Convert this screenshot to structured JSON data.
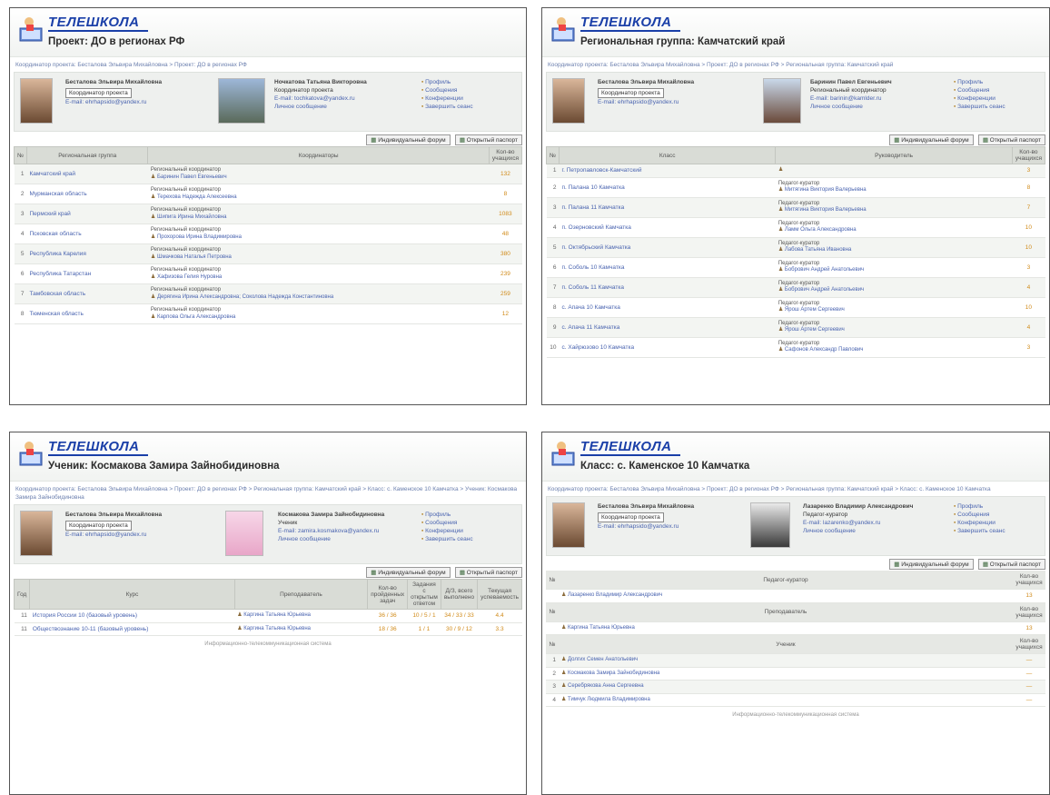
{
  "brand": "ТЕЛЕШКОЛА",
  "colors": {
    "brand": "#1a3fa8",
    "link": "#4a64b0",
    "value": "#d18b1a"
  },
  "common": {
    "coordinator_name": "Бесталова Эльвира Михайловна",
    "coordinator_role": "Координатор проекта",
    "coordinator_email": "E-mail: ehrhapsido@yandex.ru",
    "side_links": [
      "Профиль",
      "Сообщения",
      "Конференции",
      "Завершить сеанс"
    ],
    "btn_calendar": "Индивидуальный форум",
    "btn_report": "Открытый паспорт",
    "footer": "Информационно-телекоммуникационная система"
  },
  "panel1": {
    "title": "Проект: ДО в регионах РФ",
    "crumbs": "Координатор проекта: Бесталова Эльвира Михайловна > Проект: ДО в регионах РФ",
    "user2_name": "Ночкатова Татьяна Викторовна",
    "user2_role": "Координатор проекта",
    "user2_email": "E-mail: tochkatova@yandex.ru",
    "user2_msg": "Личное сообщение",
    "headers": [
      "№",
      "Региональная группа",
      "Координаторы",
      "Кол-во учащихся"
    ],
    "rows": [
      {
        "n": "1",
        "name": "Камчатский край",
        "role": "Региональный координатор",
        "person": "Баринин Павел Евгеньевич",
        "v": "132"
      },
      {
        "n": "2",
        "name": "Мурманская область",
        "role": "Региональный координатор",
        "person": "Терехова Надежда Алексеевна",
        "v": "8"
      },
      {
        "n": "3",
        "name": "Пермский край",
        "role": "Региональный координатор",
        "person": "Шипига Ирина Михайловна",
        "v": "1083"
      },
      {
        "n": "4",
        "name": "Псковская область",
        "role": "Региональный координатор",
        "person": "Прохорова Ирина Владимировна",
        "v": "48"
      },
      {
        "n": "5",
        "name": "Республика Карелия",
        "role": "Региональный координатор",
        "person": "Шмачкова Наталья Петровна",
        "v": "380"
      },
      {
        "n": "6",
        "name": "Республика Татарстан",
        "role": "Региональный координатор",
        "person": "Хафизова Гелия Нуровна",
        "v": "239"
      },
      {
        "n": "7",
        "name": "Тамбовская область",
        "role": "Региональный координатор",
        "person": "Дерягина Ирина Александровна; Соколова Надежда Константиновна",
        "v": "259"
      },
      {
        "n": "8",
        "name": "Тюменская область",
        "role": "Региональный координатор",
        "person": "Карпова Ольга Александровна",
        "v": "12"
      }
    ]
  },
  "panel2": {
    "title": "Региональная группа: Камчатский край",
    "crumbs": "Координатор проекта: Бесталова Эльвира Михайловна > Проект: ДО в регионах РФ > Региональная группа: Камчатский край",
    "user2_name": "Баринин Павел Евгеньевич",
    "user2_role": "Региональный координатор",
    "user2_email": "E-mail: barinin@kamlder.ru",
    "user2_msg": "Личное сообщение",
    "headers": [
      "№",
      "Класс",
      "Руководитель",
      "Кол-во учащихся"
    ],
    "rows": [
      {
        "n": "1",
        "name": "г. Петропавловск-Камчатский",
        "role": "",
        "person": "",
        "v": "3"
      },
      {
        "n": "2",
        "name": "п. Палана 10 Камчатка",
        "role": "Педагог-куратор",
        "person": "Митягина Виктория Валерьевна",
        "v": "8"
      },
      {
        "n": "3",
        "name": "п. Палана 11 Камчатка",
        "role": "Педагог-куратор",
        "person": "Митягина Виктория Валерьевна",
        "v": "7"
      },
      {
        "n": "4",
        "name": "п. Озерновский Камчатка",
        "role": "Педагог-куратор",
        "person": "Ламм Ольга Александровна",
        "v": "10"
      },
      {
        "n": "5",
        "name": "п. Октябрьский Камчатка",
        "role": "Педагог-куратор",
        "person": "Лабова Татьяна Ивановна",
        "v": "10"
      },
      {
        "n": "6",
        "name": "п. Соболь 10 Камчатка",
        "role": "Педагог-куратор",
        "person": "Бобрович Андрей Анатольевич",
        "v": "3"
      },
      {
        "n": "7",
        "name": "п. Соболь 11 Камчатка",
        "role": "Педагог-куратор",
        "person": "Бобрович Андрей Анатольевич",
        "v": "4"
      },
      {
        "n": "8",
        "name": "с. Апача 10 Камчатка",
        "role": "Педагог-куратор",
        "person": "Ярош Артем Сергеевич",
        "v": "10"
      },
      {
        "n": "9",
        "name": "с. Апача 11 Камчатка",
        "role": "Педагог-куратор",
        "person": "Ярош Артем Сергеевич",
        "v": "4"
      },
      {
        "n": "10",
        "name": "с. Хайрюзово 10 Камчатка",
        "role": "Педагог-куратор",
        "person": "Сафонов Александр Павлович",
        "v": "3"
      }
    ]
  },
  "panel3": {
    "title": "Ученик: Космакова Замира Зайнобидиновна",
    "crumbs": "Координатор проекта: Бесталова Эльвира Михайловна > Проект: ДО в регионах РФ > Региональная группа: Камчатский край > Класс: с. Каменское 10 Камчатка > Ученик: Космакова Замира Зайнобидиновна",
    "user2_name": "Космакова Замира Зайнобидиновна",
    "user2_role": "Ученик",
    "user2_email": "E-mail: zamira.kosmakova@yandex.ru",
    "user2_msg": "Личное сообщение",
    "headers": [
      "Год",
      "Курс",
      "Преподаватель",
      "Кол-во пройденных задач",
      "Задания с открытым ответом",
      "Д/З, всего выполнено",
      "Текущая успеваемость"
    ],
    "rows": [
      {
        "n": "11",
        "name": "История России 10 (базовый уровень)",
        "person": "Каргина Татьяна Юрьевна",
        "a": "36 / 36",
        "b": "10 / 5 / 1",
        "c": "34 / 33 / 33",
        "d": "4.4"
      },
      {
        "n": "11",
        "name": "Обществознание 10-11 (базовый уровень)",
        "person": "Каргина Татьяна Юрьевна",
        "a": "18 / 36",
        "b": "1 / 1",
        "c": "30 / 9 / 12",
        "d": "3.3"
      }
    ]
  },
  "panel4": {
    "title": "Класс: с. Каменское 10 Камчатка",
    "crumbs": "Координатор проекта: Бесталова Эльвира Михайловна > Проект: ДО в регионах РФ > Региональная группа: Камчатский край > Класс: с. Каменское 10 Камчатка",
    "user2_name": "Лазаренко Владимир Александрович",
    "user2_role": "Педагог-куратор",
    "user2_email": "E-mail: lazarenko@yandex.ru",
    "user2_msg": "Личное сообщение",
    "sec1": "Педагог-куратор",
    "sec1_person": "Лазаренко Владимир Александрович",
    "sec1_v": "13",
    "sec2": "Преподаватель",
    "sec2_person": "Каргина Татьяна Юрьевна",
    "sec2_v": "13",
    "sec3": "Ученик",
    "count_header": "Кол-во учащихся",
    "students": [
      {
        "n": "1",
        "person": "Долгих Семен Анатольевич",
        "v": "—"
      },
      {
        "n": "2",
        "person": "Космакова Замира Зайнобидиновна",
        "v": "—"
      },
      {
        "n": "3",
        "person": "Серебрякова Анна Сергеевна",
        "v": "—"
      },
      {
        "n": "4",
        "person": "Тимчук Людмила Владимировна",
        "v": "—"
      }
    ]
  }
}
